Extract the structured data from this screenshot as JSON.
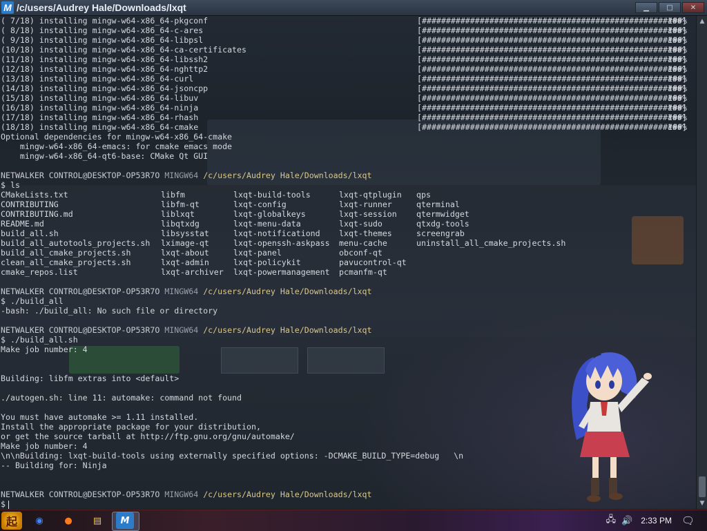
{
  "window": {
    "title": "/c/users/Audrey Hale/Downloads/lxqt",
    "logo_letter": "M",
    "controls": {
      "minimize": "▁",
      "maximize": "□",
      "close": "✕"
    }
  },
  "terminal": {
    "install_lines": [
      {
        "num": "( 7/18)",
        "pkg": "installing mingw-w64-x86_64-pkgconf"
      },
      {
        "num": "( 8/18)",
        "pkg": "installing mingw-w64-x86_64-c-ares"
      },
      {
        "num": "( 9/18)",
        "pkg": "installing mingw-w64-x86_64-libpsl"
      },
      {
        "num": "(10/18)",
        "pkg": "installing mingw-w64-x86_64-ca-certificates"
      },
      {
        "num": "(11/18)",
        "pkg": "installing mingw-w64-x86_64-libssh2"
      },
      {
        "num": "(12/18)",
        "pkg": "installing mingw-w64-x86_64-nghttp2"
      },
      {
        "num": "(13/18)",
        "pkg": "installing mingw-w64-x86_64-curl"
      },
      {
        "num": "(14/18)",
        "pkg": "installing mingw-w64-x86_64-jsoncpp"
      },
      {
        "num": "(15/18)",
        "pkg": "installing mingw-w64-x86_64-libuv"
      },
      {
        "num": "(16/18)",
        "pkg": "installing mingw-w64-x86_64-ninja"
      },
      {
        "num": "(17/18)",
        "pkg": "installing mingw-w64-x86_64-rhash"
      },
      {
        "num": "(18/18)",
        "pkg": "installing mingw-w64-x86_64-cmake"
      }
    ],
    "progress_bar": "[######################################################]",
    "progress_pct": "100%",
    "optional_deps": [
      "Optional dependencies for mingw-w64-x86_64-cmake",
      "    mingw-w64-x86_64-emacs: for cmake emacs mode",
      "    mingw-w64-x86_64-qt6-base: CMake Qt GUI"
    ],
    "prompt": {
      "user_host": "NETWALKER CONTROL@DESKTOP-OP53R7O",
      "shell": "MINGW64",
      "path": "/c/users/Audrey Hale/Downloads/lxqt",
      "symbol": "$"
    },
    "cmd_ls": "$ ls",
    "ls_rows": [
      [
        "CMakeLists.txt",
        "libfm",
        "lxqt-build-tools",
        "lxqt-qtplugin",
        "qps"
      ],
      [
        "CONTRIBUTING",
        "libfm-qt",
        "lxqt-config",
        "lxqt-runner",
        "qterminal"
      ],
      [
        "CONTRIBUTING.md",
        "liblxqt",
        "lxqt-globalkeys",
        "lxqt-session",
        "qtermwidget"
      ],
      [
        "README.md",
        "libqtxdg",
        "lxqt-menu-data",
        "lxqt-sudo",
        "qtxdg-tools"
      ],
      [
        "build_all.sh",
        "libsysstat",
        "lxqt-notificationd",
        "lxqt-themes",
        "screengrab"
      ],
      [
        "build_all_autotools_projects.sh",
        "lximage-qt",
        "lxqt-openssh-askpass",
        "menu-cache",
        "uninstall_all_cmake_projects.sh"
      ],
      [
        "build_all_cmake_projects.sh",
        "lxqt-about",
        "lxqt-panel",
        "obconf-qt",
        ""
      ],
      [
        "clean_all_cmake_projects.sh",
        "lxqt-admin",
        "lxqt-policykit",
        "pavucontrol-qt",
        ""
      ],
      [
        "cmake_repos.list",
        "lxqt-archiver",
        "lxqt-powermanagement",
        "pcmanfm-qt",
        ""
      ]
    ],
    "cmd_build_all": "$ ./build_all",
    "err_build_all": "-bash: ./build_all: No such file or directory",
    "cmd_build_all_sh": "$ ./build_all.sh",
    "build_output": [
      "Make job number: 4",
      "",
      "",
      "Building: libfm extras into <default>",
      "",
      "./autogen.sh: line 11: automake: command not found",
      "",
      "You must have automake >= 1.11 installed.",
      "Install the appropriate package for your distribution,",
      "or get the source tarball at http://ftp.gnu.org/gnu/automake/",
      "Make job number: 4",
      "\\n\\nBuilding: lxqt-build-tools using externally specified options: -DCMAKE_BUILD_TYPE=debug   \\n",
      "-- Building for: Ninja"
    ],
    "final_prompt_symbol": "$"
  },
  "taskbar": {
    "start_glyph": "起",
    "apps": [
      {
        "name": "chrome",
        "glyph": "◉",
        "color": "#4285f4"
      },
      {
        "name": "firefox",
        "glyph": "●",
        "color": "#ff7a1a"
      },
      {
        "name": "explorer",
        "glyph": "▤",
        "color": "#f0c24a"
      },
      {
        "name": "msys2",
        "glyph": "M",
        "color": "#2d7cc9"
      }
    ],
    "clock": "2:33 PM",
    "tray_icons": [
      "network-icon",
      "volume-icon"
    ]
  },
  "colors": {
    "prompt_path": "#d8c88a",
    "terminal_text": "#d4d8de"
  }
}
